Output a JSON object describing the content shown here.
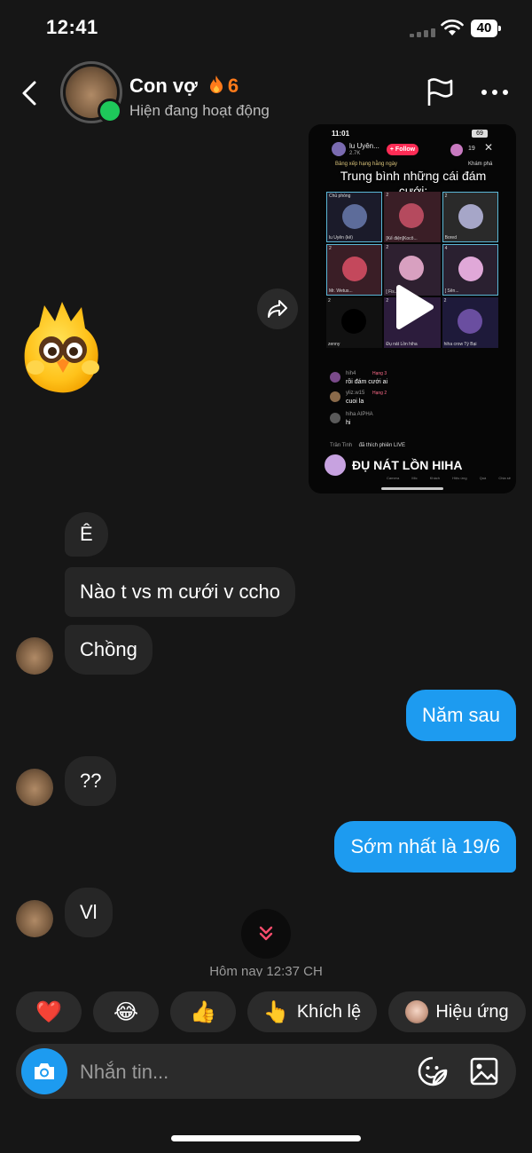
{
  "status_bar": {
    "time": "12:41",
    "battery": "40"
  },
  "header": {
    "name": "Con vợ",
    "streak_icon": "fire-icon",
    "streak_count": "6",
    "status": "Hiện đang hoạt động"
  },
  "video_card": {
    "status_time": "11:01",
    "host_name": "lu Uyên...",
    "host_followers": "2.7K",
    "follow_label": "+ Follow",
    "viewer_count": "19",
    "rank_label": "Bảng xếp hạng hằng ngày",
    "explore_label": "Khám phá",
    "overlay_title": "Trung bình những cái đám cưới:",
    "tiles": [
      {
        "tag": "Chủ phòng",
        "name": "lu Uyên (kê)"
      },
      {
        "tag": "2",
        "name": "[Kể điện]Kocô..."
      },
      {
        "tag": "2",
        "name": "Bored"
      },
      {
        "tag": "2",
        "name": "Mr. Wetus..."
      },
      {
        "tag": "2",
        "name": "[ Fis..."
      },
      {
        "tag": "4",
        "name": "[ Sên..."
      },
      {
        "tag": "2",
        "name": "zenny"
      },
      {
        "tag": "2",
        "name": "Đụ nát Lồn hiha"
      },
      {
        "tag": "2",
        "name": "hiha crow Tý Bại"
      }
    ],
    "comments": [
      {
        "user": "hih4",
        "badge": "Hạng 3",
        "text": "rồi đám cưới ai"
      },
      {
        "user": "yliz.w15",
        "badge": "Hạng 2",
        "text": "cuoi la"
      },
      {
        "user": "hiha AIPHA",
        "badge": "",
        "text": "hi"
      },
      {
        "user": "Trần Tinh",
        "badge": "",
        "text": "đã thích phiên LIVE"
      }
    ],
    "caption": "ĐỤ NÁT LỒN HIHA",
    "nav_items": [
      "Camera",
      "Mic",
      "Khách",
      "Hiệu ứng",
      "Quà",
      "Chia sẻ"
    ]
  },
  "messages": [
    {
      "side": "in",
      "text": "Ê"
    },
    {
      "side": "in",
      "text": "Nào t vs m cưới v ccho"
    },
    {
      "side": "in",
      "text": "Chồng"
    },
    {
      "side": "out",
      "text": "Năm sau"
    },
    {
      "side": "in",
      "text": "??"
    },
    {
      "side": "out",
      "text": "Sớm nhất là 19/6"
    },
    {
      "side": "in",
      "text": "Vl"
    }
  ],
  "timestamp": "Hôm nay 12:37 CH",
  "quick_reactions": [
    {
      "emoji": "❤️",
      "label": ""
    },
    {
      "emoji": "😂",
      "label": ""
    },
    {
      "emoji": "👍",
      "label": ""
    },
    {
      "emoji": "👆",
      "label": "Khích lệ"
    },
    {
      "emoji": "",
      "label": "Hiệu ứng"
    }
  ],
  "composer": {
    "placeholder": "Nhắn tin..."
  },
  "colors": {
    "accent": "#1d9bf0",
    "online": "#1ec85a",
    "streak": "#ff7a1a"
  }
}
